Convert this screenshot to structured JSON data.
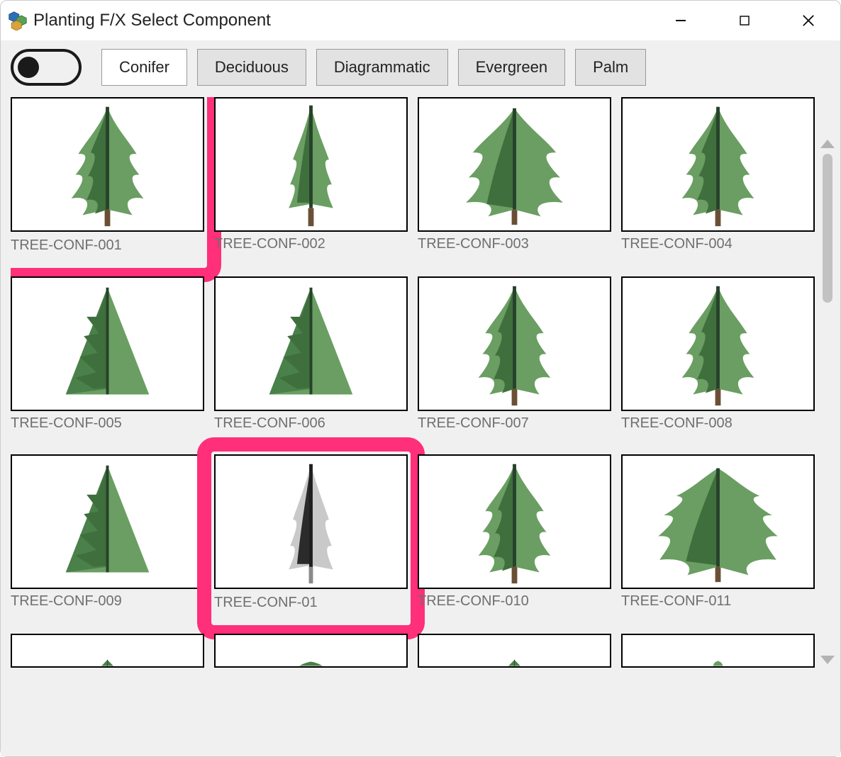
{
  "window": {
    "title": "Planting F/X Select Component"
  },
  "toolbar": {
    "toggle_on": false,
    "tabs": [
      {
        "label": "Conifer",
        "active": true
      },
      {
        "label": "Deciduous",
        "active": false
      },
      {
        "label": "Diagrammatic",
        "active": false
      },
      {
        "label": "Evergreen",
        "active": false
      },
      {
        "label": "Palm",
        "active": false
      }
    ]
  },
  "highlight_color": "#ff2f7a",
  "components": [
    {
      "id": "TREE-CONF-001",
      "highlighted": true
    },
    {
      "id": "TREE-CONF-002"
    },
    {
      "id": "TREE-CONF-003"
    },
    {
      "id": "TREE-CONF-004"
    },
    {
      "id": "TREE-CONF-005"
    },
    {
      "id": "TREE-CONF-006"
    },
    {
      "id": "TREE-CONF-007"
    },
    {
      "id": "TREE-CONF-008"
    },
    {
      "id": "TREE-CONF-009"
    },
    {
      "id": "TREE-CONF-01",
      "highlighted": true,
      "variant": "gray"
    },
    {
      "id": "TREE-CONF-010"
    },
    {
      "id": "TREE-CONF-011"
    }
  ]
}
